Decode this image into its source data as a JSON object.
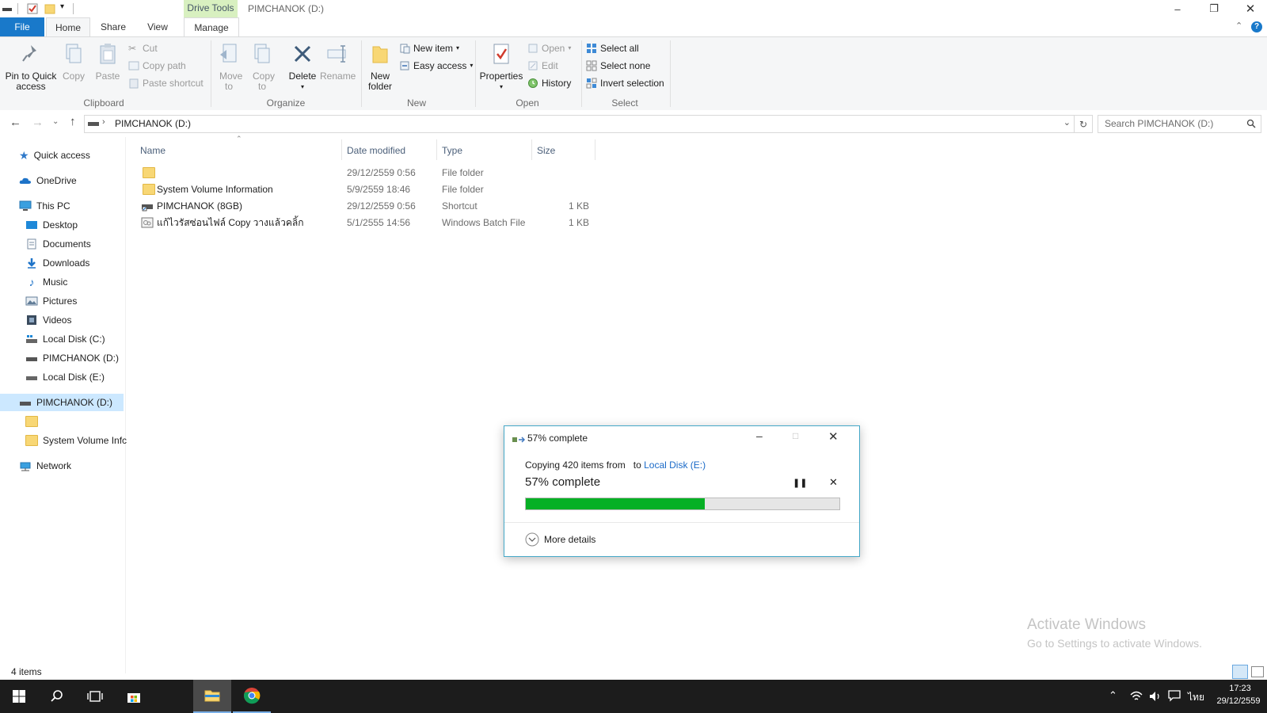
{
  "window": {
    "title": "PIMCHANOK (D:)",
    "context_tab_group": "Drive Tools"
  },
  "tabs": [
    "File",
    "Home",
    "Share",
    "View",
    "Manage"
  ],
  "ribbon": {
    "clipboard": {
      "label": "Clipboard",
      "pin": "Pin to Quick access",
      "copy": "Copy",
      "paste": "Paste",
      "cut": "Cut",
      "copy_path": "Copy path",
      "paste_shortcut": "Paste shortcut"
    },
    "organize": {
      "label": "Organize",
      "move_to": "Move to",
      "copy_to": "Copy to",
      "delete": "Delete",
      "rename": "Rename"
    },
    "new": {
      "label": "New",
      "new_folder": "New folder",
      "new_item": "New item",
      "easy_access": "Easy access"
    },
    "open": {
      "label": "Open",
      "properties": "Properties",
      "open": "Open",
      "edit": "Edit",
      "history": "History"
    },
    "select": {
      "label": "Select",
      "select_all": "Select all",
      "select_none": "Select none",
      "invert": "Invert selection"
    }
  },
  "address": {
    "path": "PIMCHANOK (D:)",
    "search_placeholder": "Search PIMCHANOK (D:)"
  },
  "nav": {
    "quick_access": "Quick access",
    "onedrive": "OneDrive",
    "this_pc": "This PC",
    "pc_items": [
      "Desktop",
      "Documents",
      "Downloads",
      "Music",
      "Pictures",
      "Videos",
      "Local Disk (C:)",
      "PIMCHANOK (D:)",
      "Local Disk (E:)"
    ],
    "drive": "PIMCHANOK (D:)",
    "drive_items": [
      "",
      "System Volume Infc"
    ],
    "network": "Network"
  },
  "columns": [
    "Name",
    "Date modified",
    "Type",
    "Size"
  ],
  "files": [
    {
      "name": "",
      "date": "29/12/2559 0:56",
      "type": "File folder",
      "size": ""
    },
    {
      "name": "System Volume Information",
      "date": "5/9/2559 18:46",
      "type": "File folder",
      "size": ""
    },
    {
      "name": "PIMCHANOK (8GB)",
      "date": "29/12/2559 0:56",
      "type": "Shortcut",
      "size": "1 KB"
    },
    {
      "name": "แก้ไวรัสซ่อนไฟล์ Copy วางแล้วคลิ้ก",
      "date": "5/1/2555 14:56",
      "type": "Windows Batch File",
      "size": "1 KB"
    }
  ],
  "status": {
    "items": "4 items"
  },
  "dialog": {
    "title": "57% complete",
    "copying_prefix": "Copying 420 items from",
    "to_word": "to",
    "destination": "Local Disk (E:)",
    "progress_text": "57% complete",
    "progress": 0.57,
    "more_details": "More details"
  },
  "watermark": {
    "title": "Activate Windows",
    "subtitle": "Go to Settings to activate Windows."
  },
  "taskbar": {
    "time": "17:23",
    "date": "29/12/2559",
    "lang": "ไทย"
  },
  "colors": {
    "accent": "#1979ca",
    "progress": "#06b025",
    "selection": "#cce8ff",
    "context_tab": "#d8f0c0"
  }
}
